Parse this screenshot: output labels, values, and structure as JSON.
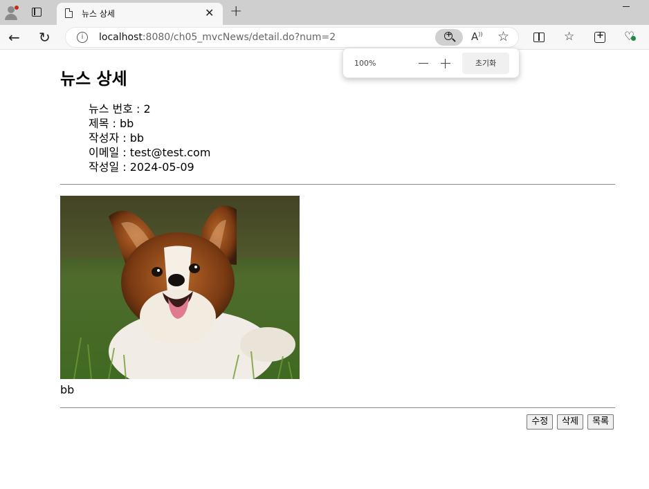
{
  "browser": {
    "tab_title": "뉴스 상세",
    "url_host": "localhost",
    "url_rest": ":8080/ch05_mvcNews/detail.do?num=2",
    "zoom_percent": "100%",
    "zoom_reset_label": "초기화"
  },
  "page": {
    "heading": "뉴스 상세",
    "fields": [
      "뉴스 번호 : 2",
      "제목 : bb",
      "작성자 : bb",
      "이메일 : test@test.com",
      "작성일 : 2024-05-09"
    ],
    "content_text": "bb",
    "buttons": {
      "edit": "수정",
      "delete": "삭제",
      "list": "목록"
    }
  }
}
